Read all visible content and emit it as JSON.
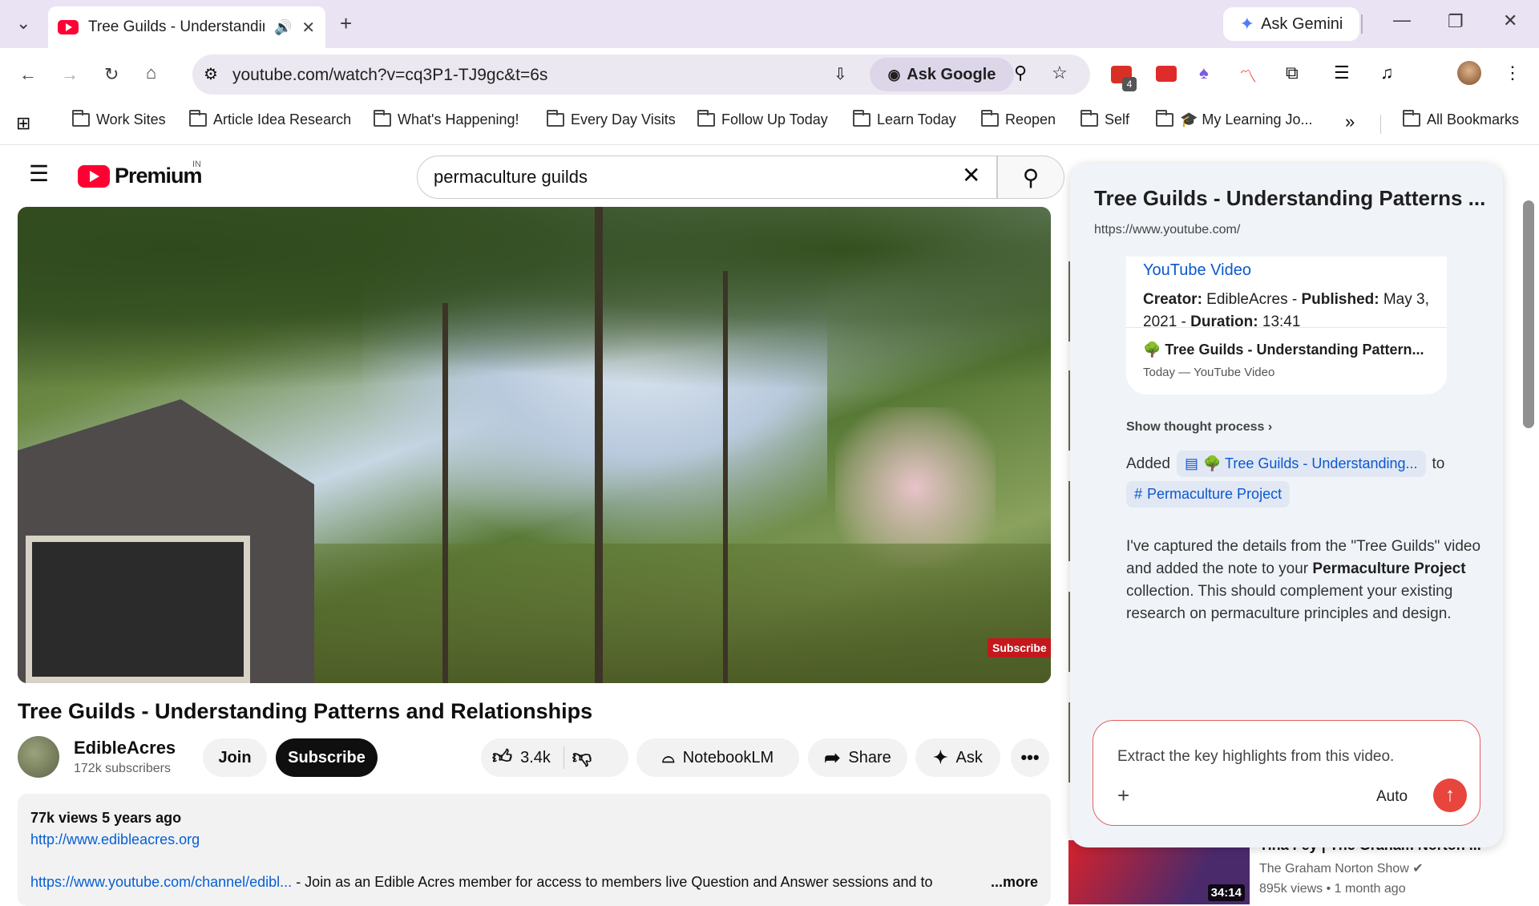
{
  "browser": {
    "tab_title": "Tree Guilds - Understanding Patterns and Relationships",
    "ask_gemini": "Ask Gemini",
    "url": "youtube.com/watch?v=cq3P1-TJ9gc&t=6s",
    "ask_google": "Ask Google",
    "extension_badge": "4",
    "bookmarks": [
      "Work Sites",
      "Article Idea Research",
      "What's Happening!",
      "Every Day Visits",
      "Follow Up Today",
      "Learn Today",
      "Reopen",
      "Self",
      "🎓 My Learning Jo..."
    ],
    "all_bookmarks": "All Bookmarks"
  },
  "youtube": {
    "logo_text": "Premium",
    "region": "IN",
    "search_value": "permaculture guilds",
    "video_overlay": "Subscribe",
    "video_title": "Tree Guilds - Understanding Patterns and Relationships",
    "channel_name": "EdibleAcres",
    "channel_subs": "172k subscribers",
    "join_label": "Join",
    "subscribe_label": "Subscribe",
    "like_count": "3.4k",
    "notebooklm_label": "NotebookLM",
    "share_label": "Share",
    "ask_label": "Ask",
    "desc_meta": "77k views  5 years ago",
    "desc_link1": "http://www.edibleacres.org",
    "desc_link2": "https://www.youtube.com/channel/edibl...",
    "desc_text": " - Join as an Edible Acres member for access to members live Question and Answer sessions and to",
    "desc_more": "...more",
    "rec_title": "Tina Fey | The Graham Norton ...",
    "rec_channel": "The Graham Norton Show",
    "rec_views": "895k views • 1 month ago",
    "rec_duration": "34:14"
  },
  "gemini_panel": {
    "title": "Tree Guilds - Understanding Patterns ...",
    "url": "https://www.youtube.com/",
    "card_title": "YouTube Video",
    "card_meta_creator_label": "Creator:",
    "card_meta_creator": " EdibleAcres - ",
    "card_meta_published_label": "Published:",
    "card_meta_published": " May 3, 2021 - ",
    "card_meta_duration_label": "Duration:",
    "card_meta_duration": " 13:41",
    "source_title": "🌳 Tree Guilds - Understanding Pattern...",
    "source_sub": "Today — YouTube Video",
    "show_thought": "Show thought process",
    "added_label": "Added",
    "added_chip": "🌳 Tree Guilds - Understanding...",
    "to_label": "to",
    "collection_chip": "Permaculture Project",
    "body_1": "I've captured the details from the \"Tree Guilds\" video and added the note to your ",
    "body_bold_1": "Permaculture Project",
    "body_2": " collection. This should complement your existing research on permaculture principles and design.",
    "input_value": "Extract the key highlights from this video.",
    "auto_label": "Auto"
  }
}
